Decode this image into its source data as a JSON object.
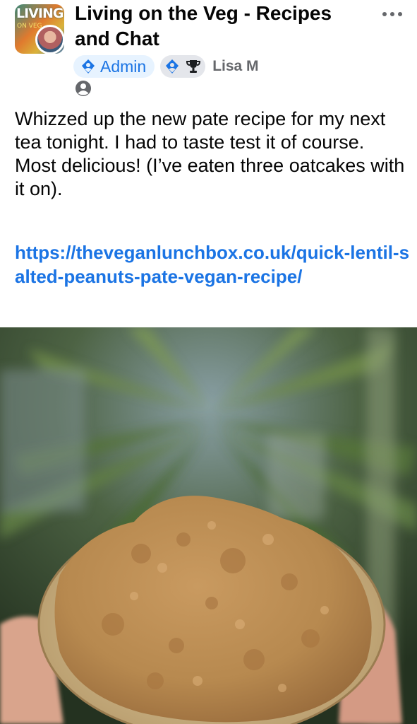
{
  "header": {
    "group_avatar_text": "LIVING",
    "group_avatar_sub": "ON VEG",
    "group_name": "Living on the Veg - Recipes and Chat",
    "more_icon": "more-horizontal-icon",
    "admin_badge": {
      "icon": "shield-icon",
      "label": "Admin"
    },
    "extra_badges": [
      "shield-icon",
      "trophy-icon"
    ],
    "author_name": "Lisa M",
    "audience_icon": "group-members-icon"
  },
  "post": {
    "text": "Whizzed up the new pate recipe for my next tea tonight. I had to taste test it of course. Most delicious! (I’ve eaten three oatcakes with it on).",
    "link": "https://theveganlunchbox.co.uk/quick-lentil-salted-peanuts-pate-vegan-recipe/"
  },
  "photo": {
    "subject": "oatcake-with-pate-photo"
  },
  "colors": {
    "link_blue": "#1b74e4",
    "admin_badge_bg": "#e7f3ff",
    "secondary_text": "#65676b",
    "primary_text": "#050505"
  }
}
